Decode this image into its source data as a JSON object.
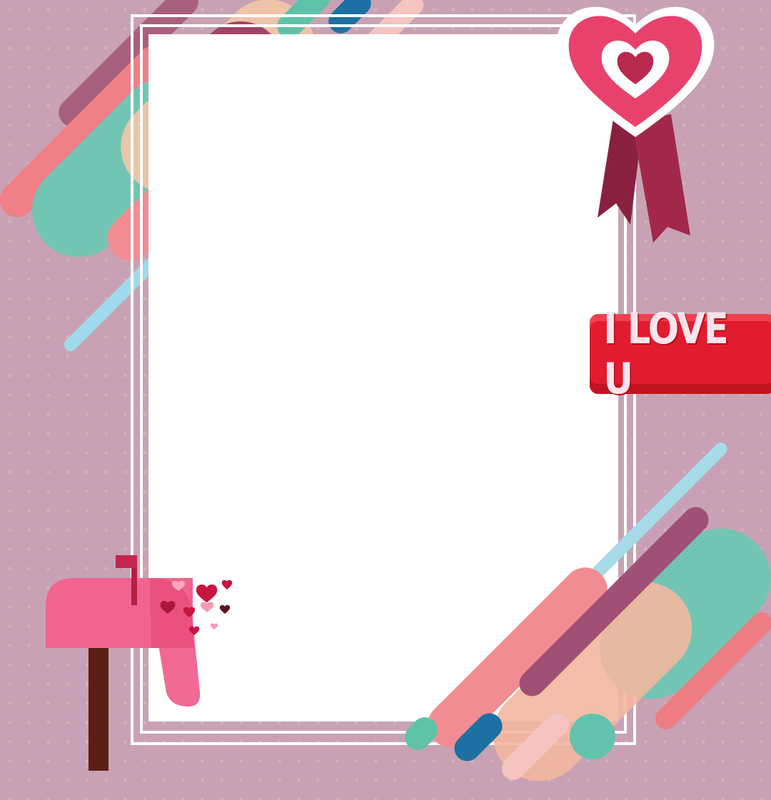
{
  "banner": {
    "text": "I LOVE U"
  },
  "colors": {
    "background": "#c8a2b4",
    "pink": "#f08a8f",
    "teal": "#6fc7b4",
    "plum": "#a04468",
    "red": "#e31b2e"
  },
  "icons": [
    "heart-ribbon-icon",
    "mailbox-icon",
    "heart-icon"
  ]
}
